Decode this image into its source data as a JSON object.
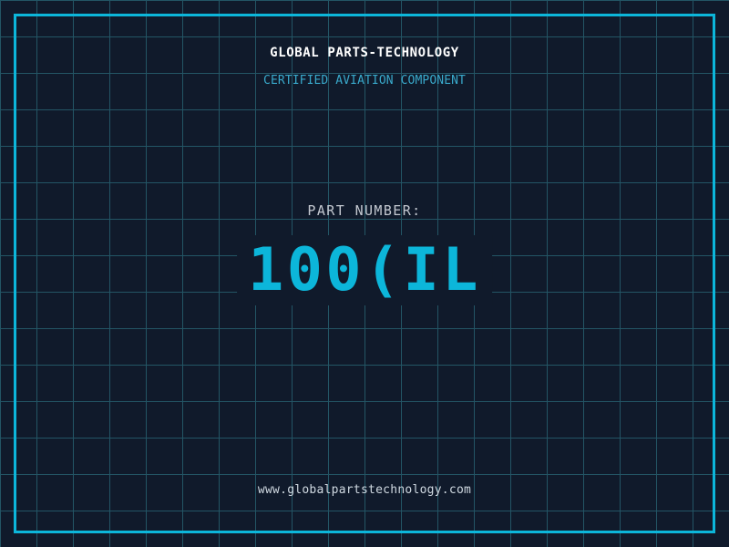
{
  "theme": {
    "background": "#101a2b",
    "grid_line": "#235565",
    "frame_accent": "#0cb6da",
    "title_color": "#ffffff",
    "subtitle_color": "#39a9cb",
    "label_color": "#c2c7cf",
    "part_number_color": "#0cb6da",
    "footer_color": "#d0d9e1"
  },
  "header": {
    "title": "GLOBAL PARTS-TECHNOLOGY",
    "subtitle": "CERTIFIED AVIATION COMPONENT"
  },
  "part": {
    "label": "PART NUMBER:",
    "number": "100(IL"
  },
  "footer": {
    "url": "www.globalpartstechnology.com"
  }
}
